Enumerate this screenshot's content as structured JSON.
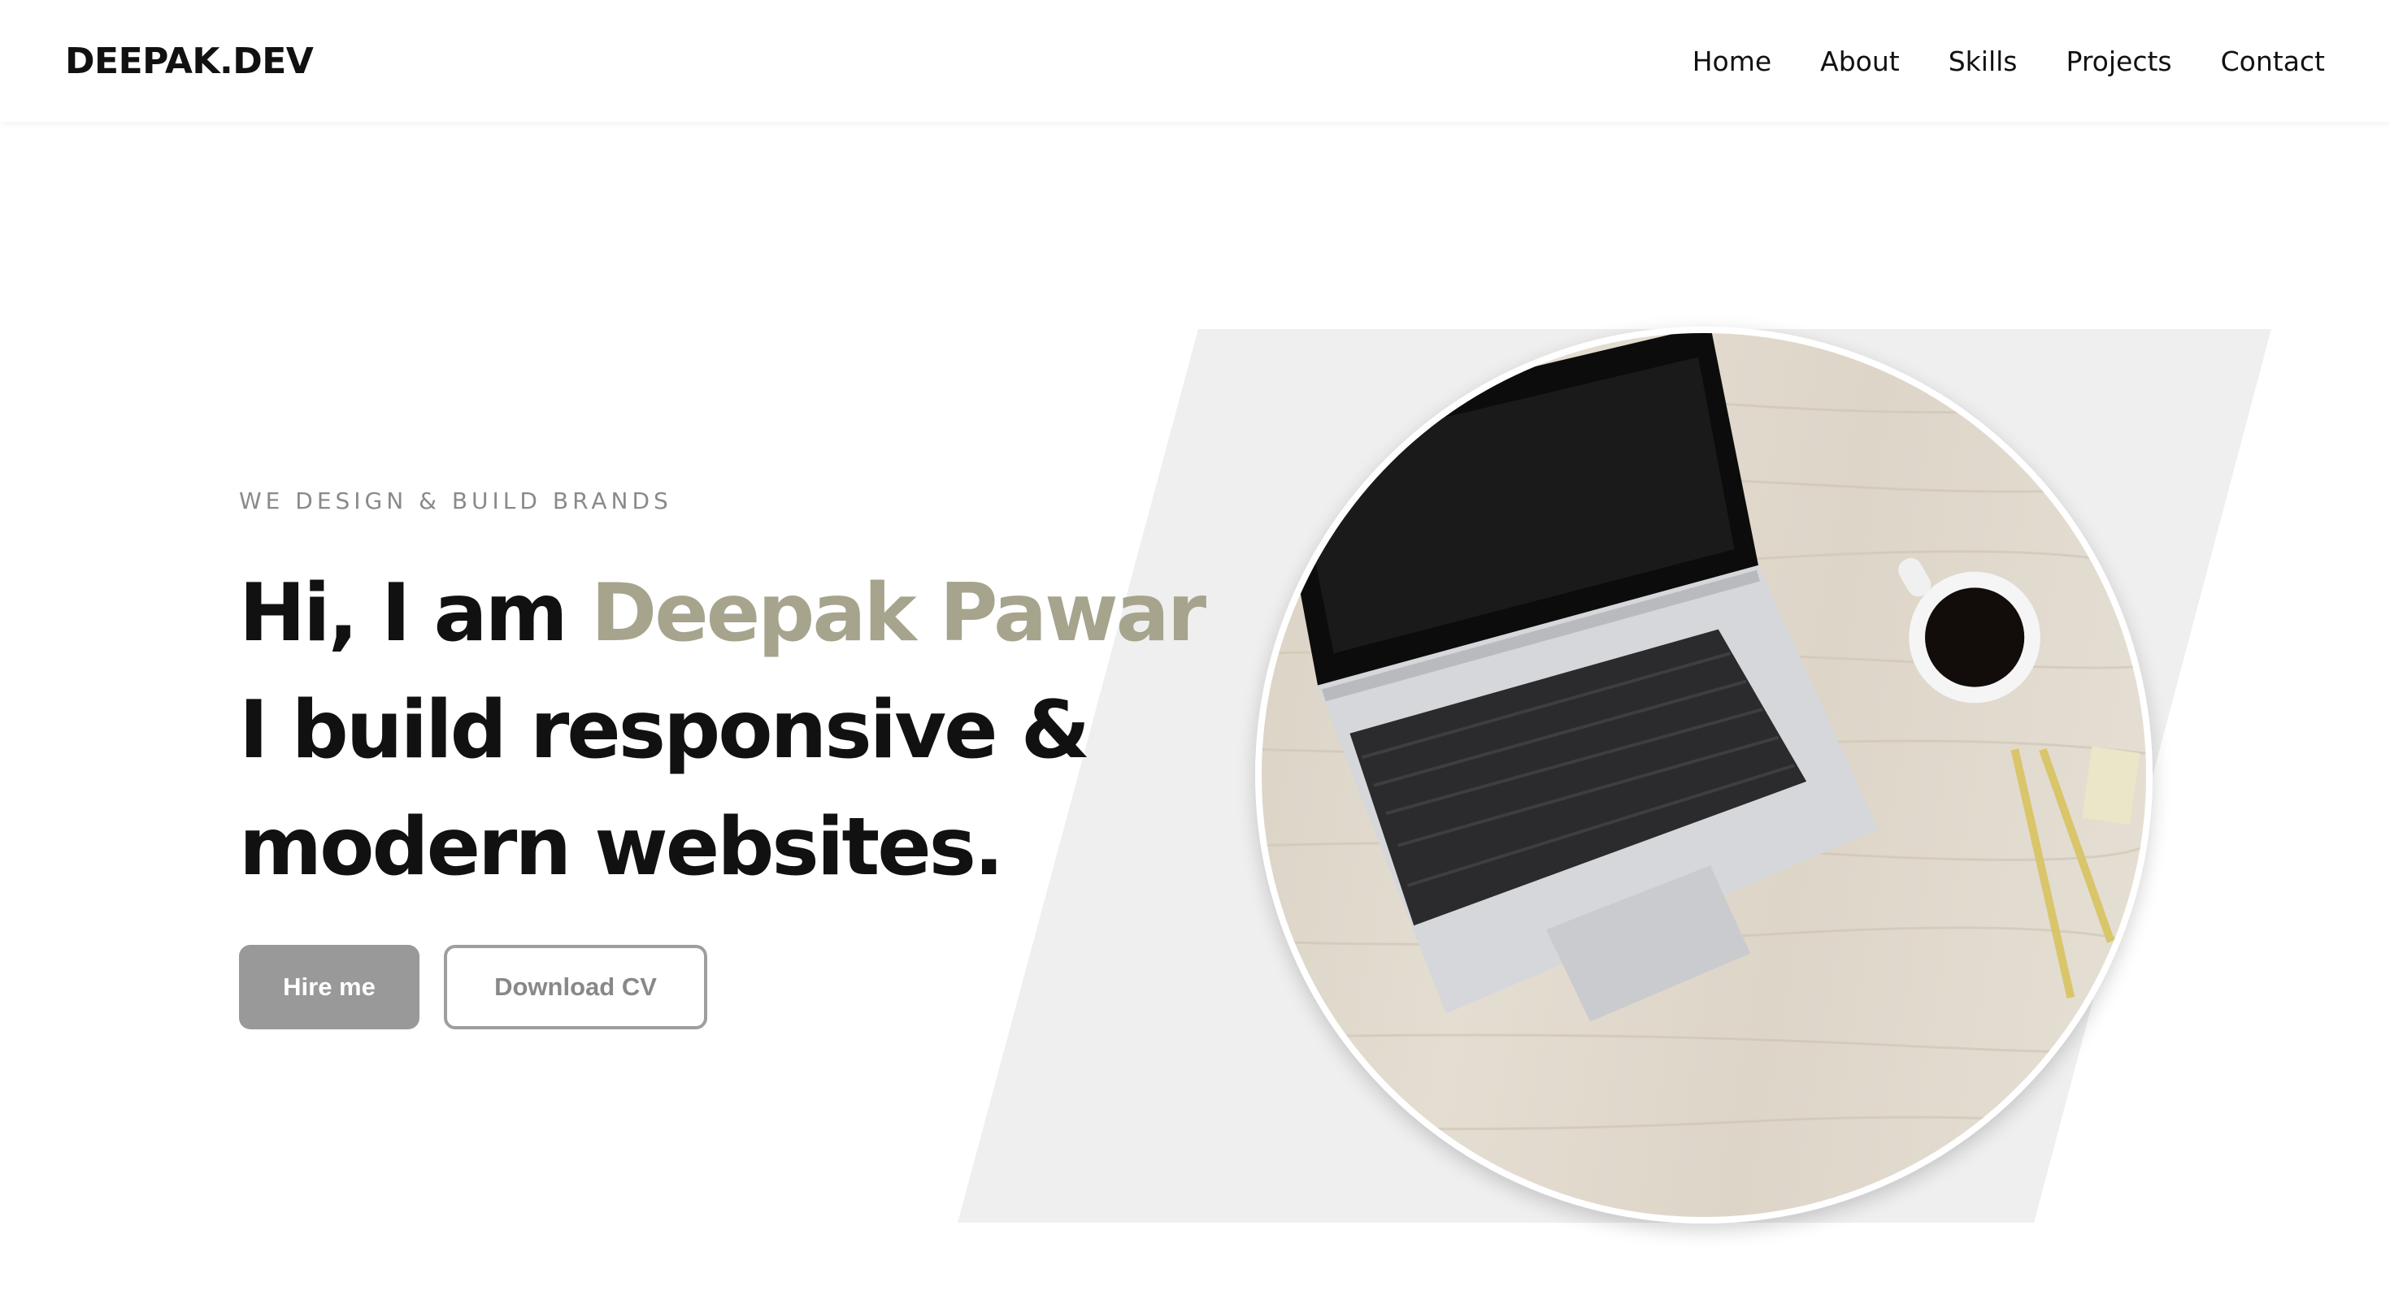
{
  "nav": {
    "logo": "DEEPAK.DEV",
    "links": [
      "Home",
      "About",
      "Skills",
      "Projects",
      "Contact"
    ]
  },
  "hero": {
    "eyebrow": "WE DESIGN & BUILD BRANDS",
    "line1_prefix": "Hi, I am ",
    "line1_name": "Deepak Pawar",
    "line2": "I build responsive &",
    "line3": "modern websites.",
    "primary_button": "Hire me",
    "secondary_button": "Download CV"
  },
  "colors": {
    "accent": "#a6a48d",
    "primary_button_bg": "#999999",
    "panel_bg": "#efefef",
    "text": "#111111"
  },
  "image": {
    "icon": "laptop-desk-photo"
  }
}
